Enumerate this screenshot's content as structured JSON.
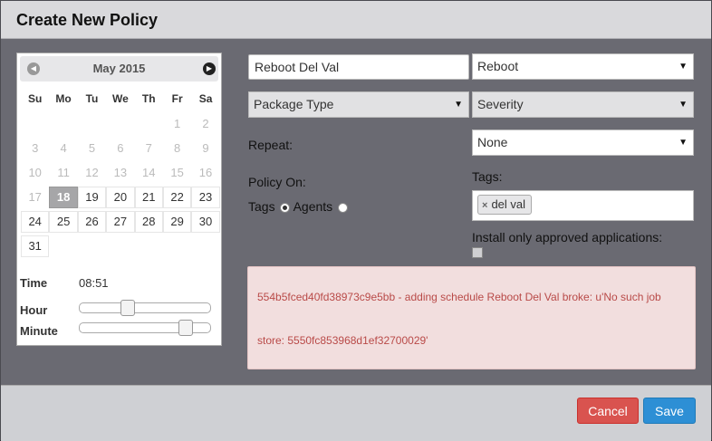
{
  "dialog": {
    "title": "Create New Policy"
  },
  "calendar": {
    "month_label": "May 2015",
    "weekdays": [
      "Su",
      "Mo",
      "Tu",
      "We",
      "Th",
      "Fr",
      "Sa"
    ],
    "weeks": [
      [
        {
          "d": "",
          "t": "empty"
        },
        {
          "d": "",
          "t": "empty"
        },
        {
          "d": "",
          "t": "empty"
        },
        {
          "d": "",
          "t": "empty"
        },
        {
          "d": "",
          "t": "empty"
        },
        {
          "d": "1",
          "t": "other"
        },
        {
          "d": "2",
          "t": "other"
        }
      ],
      [
        {
          "d": "3",
          "t": "other"
        },
        {
          "d": "4",
          "t": "other"
        },
        {
          "d": "5",
          "t": "other"
        },
        {
          "d": "6",
          "t": "other"
        },
        {
          "d": "7",
          "t": "other"
        },
        {
          "d": "8",
          "t": "other"
        },
        {
          "d": "9",
          "t": "other"
        }
      ],
      [
        {
          "d": "10",
          "t": "other"
        },
        {
          "d": "11",
          "t": "other"
        },
        {
          "d": "12",
          "t": "other"
        },
        {
          "d": "13",
          "t": "other"
        },
        {
          "d": "14",
          "t": "other"
        },
        {
          "d": "15",
          "t": "other"
        },
        {
          "d": "16",
          "t": "other"
        }
      ],
      [
        {
          "d": "17",
          "t": "other"
        },
        {
          "d": "18",
          "t": "selected"
        },
        {
          "d": "19",
          "t": "day"
        },
        {
          "d": "20",
          "t": "day"
        },
        {
          "d": "21",
          "t": "day"
        },
        {
          "d": "22",
          "t": "day"
        },
        {
          "d": "23",
          "t": "day"
        }
      ],
      [
        {
          "d": "24",
          "t": "day"
        },
        {
          "d": "25",
          "t": "day"
        },
        {
          "d": "26",
          "t": "day"
        },
        {
          "d": "27",
          "t": "day"
        },
        {
          "d": "28",
          "t": "day"
        },
        {
          "d": "29",
          "t": "day"
        },
        {
          "d": "30",
          "t": "day"
        }
      ],
      [
        {
          "d": "31",
          "t": "day"
        }
      ]
    ],
    "time_label": "Time",
    "time_value": "08:51",
    "hour_label": "Hour",
    "minute_label": "Minute",
    "hour_level": 0.35,
    "minute_level": 0.85
  },
  "form": {
    "name_value": "Reboot Del Val",
    "operation_selected": "Reboot",
    "package_type_selected": "Package Type",
    "severity_selected": "Severity",
    "repeat_label": "Repeat:",
    "repeat_selected": "None",
    "policy_on_label": "Policy On:",
    "tags_radio_label": "Tags",
    "agents_radio_label": "Agents",
    "tags_label": "Tags:",
    "tag_value": "del val",
    "approved_label": "Install only approved applications:"
  },
  "alert": {
    "line1": "554b5fced40fd38973c9e5bb - adding schedule Reboot Del Val broke: u'No such job",
    "line2": "store: 5550fc853968d1ef32700029'"
  },
  "footer": {
    "cancel_label": "Cancel",
    "save_label": "Save"
  },
  "colors": {
    "danger": "#d9534f",
    "primary": "#2d8fd5",
    "alert_bg": "#f2dede",
    "alert_text": "#b94a48"
  }
}
